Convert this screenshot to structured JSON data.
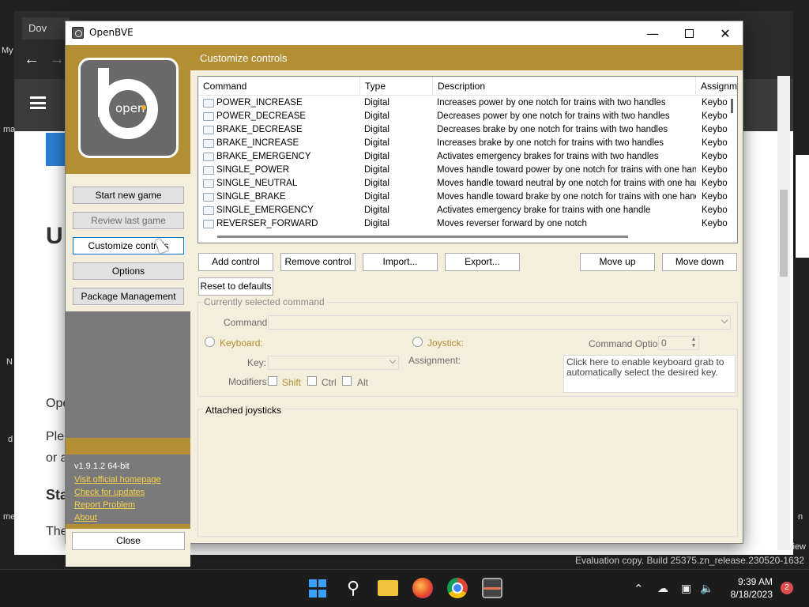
{
  "background": {
    "browser_tab": "Dov",
    "web_heading_fragment": "U",
    "web_text_1": "Ope",
    "web_text_2": "Ple",
    "web_text_3": "or a",
    "web_text_4": "Sta",
    "web_text_5": "The",
    "edge_left_1": "My",
    "edge_left_2": "ma",
    "edge_left_3": "N",
    "edge_left_4": "d",
    "edge_left_5": "me",
    "edge_right_1": "n",
    "edge_right_2": "view",
    "evaluation_text": "Evaluation copy. Build 25375.zn_release.230520-1632"
  },
  "taskbar": {
    "time": "9:39 AM",
    "date": "8/18/2023",
    "notification_count": "2",
    "icons": [
      "windows-start-icon",
      "search-icon",
      "file-explorer-icon",
      "firefox-icon",
      "chrome-icon",
      "openbve-icon"
    ]
  },
  "window": {
    "title": "OpenBVE",
    "logo_text": "open"
  },
  "nav": {
    "start_new_game": "Start new game",
    "review_last_game": "Review last game",
    "customize_controls": "Customize controls",
    "options": "Options",
    "package_management": "Package Management",
    "version": "v1.9.1.2 64-bit",
    "visit_homepage": "Visit official homepage",
    "check_updates": "Check for updates",
    "report_problem": "Report Problem",
    "about": "About",
    "close": "Close"
  },
  "controls": {
    "header": "Customize controls",
    "columns": [
      "Command",
      "Type",
      "Description",
      "Assignment"
    ],
    "rows": [
      {
        "command": "POWER_INCREASE",
        "type": "Digital",
        "description": "Increases power by one notch for trains with two handles",
        "assignment": "Keyboard"
      },
      {
        "command": "POWER_DECREASE",
        "type": "Digital",
        "description": "Decreases power by one notch for trains with two handles",
        "assignment": "Keyboard"
      },
      {
        "command": "BRAKE_DECREASE",
        "type": "Digital",
        "description": "Decreases brake by one notch for trains with two handles",
        "assignment": "Keyboard"
      },
      {
        "command": "BRAKE_INCREASE",
        "type": "Digital",
        "description": "Increases brake by one notch for trains with two handles",
        "assignment": "Keyboard"
      },
      {
        "command": "BRAKE_EMERGENCY",
        "type": "Digital",
        "description": "Activates emergency brakes for trains with two handles",
        "assignment": "Keyboard"
      },
      {
        "command": "SINGLE_POWER",
        "type": "Digital",
        "description": "Moves handle toward power by one notch for trains with one handle",
        "assignment": "Keyboard"
      },
      {
        "command": "SINGLE_NEUTRAL",
        "type": "Digital",
        "description": "Moves handle toward neutral by one notch for trains with one handle",
        "assignment": "Keyboard"
      },
      {
        "command": "SINGLE_BRAKE",
        "type": "Digital",
        "description": "Moves handle toward brake by one notch for trains with one handle",
        "assignment": "Keyboard"
      },
      {
        "command": "SINGLE_EMERGENCY",
        "type": "Digital",
        "description": "Activates emergency brake for trains with one handle",
        "assignment": "Keyboard"
      },
      {
        "command": "REVERSER_FORWARD",
        "type": "Digital",
        "description": "Moves reverser forward by one notch",
        "assignment": "Keyboard"
      }
    ],
    "add_control": "Add control",
    "remove_control": "Remove control",
    "import": "Import...",
    "export": "Export...",
    "move_up": "Move up",
    "move_down": "Move down",
    "reset_defaults": "Reset to defaults",
    "selected_group_title": "Currently selected command",
    "command_label": "Command:",
    "keyboard_label": "Keyboard:",
    "joystick_label": "Joystick:",
    "command_option_label": "Command Option:",
    "command_option_value": "0",
    "key_label": "Key:",
    "assignment_label": "Assignment:",
    "modifiers_label": "Modifiers:",
    "shift_label": "Shift",
    "ctrl_label": "Ctrl",
    "alt_label": "Alt",
    "keyboard_grab_hint": "Click here to enable keyboard grab to automatically select the desired key.",
    "attached_joysticks_title": "Attached joysticks"
  }
}
